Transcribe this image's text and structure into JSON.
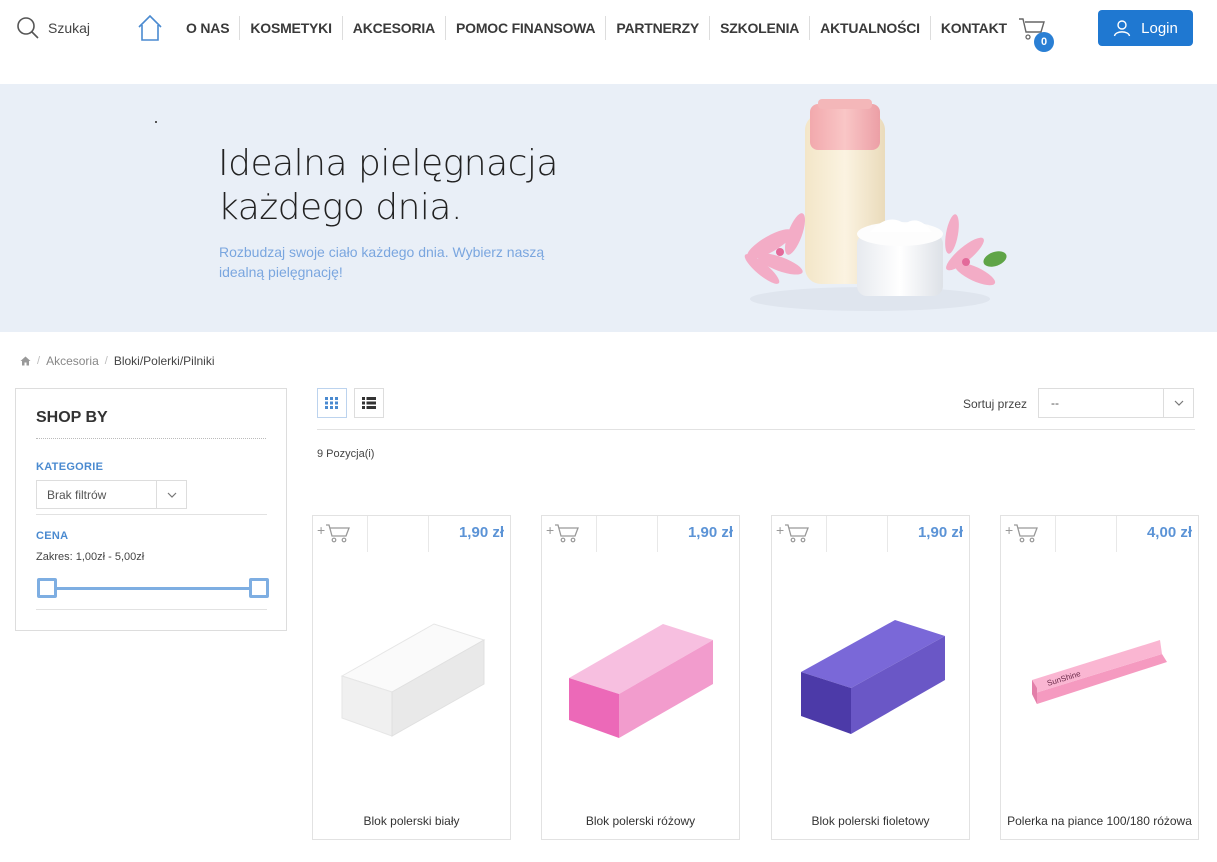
{
  "header": {
    "search_label": "Szukaj",
    "nav": [
      "O NAS",
      "KOSMETYKI",
      "AKCESORIA",
      "POMOC FINANSOWA",
      "PARTNERZY",
      "SZKOLENIA",
      "AKTUALNOŚCI",
      "KONTAKT"
    ],
    "cart_count": "0",
    "login_label": "Login"
  },
  "banner": {
    "title_line1": "Idealna pielęgnacja",
    "title_line2": "każdego dnia.",
    "subtitle_line1": "Rozbudzaj swoje ciało każdego dnia. Wybierz naszą",
    "subtitle_line2": "idealną pielęgnację!"
  },
  "breadcrumb": {
    "items": [
      "Akcesoria",
      "Bloki/Polerki/Pilniki"
    ]
  },
  "sidebar": {
    "title": "SHOP BY",
    "category_label": "KATEGORIE",
    "category_value": "Brak filtrów",
    "price_label": "CENA",
    "price_range": "Zakres: 1,00zł - 5,00zł"
  },
  "toolbar": {
    "sort_label": "Sortuj przez",
    "sort_value": "--",
    "count_text": "9 Pozycja(i)"
  },
  "products": [
    {
      "name": "Blok polerski biały",
      "price": "1,90 zł",
      "color": "#f1f1f1"
    },
    {
      "name": "Blok polerski różowy",
      "price": "1,90 zł",
      "color": "#f3a9d3"
    },
    {
      "name": "Blok polerski fioletowy",
      "price": "1,90 zł",
      "color": "#6a57c6"
    },
    {
      "name": "Polerka na piance 100/180 różowa",
      "price": "4,00 zł",
      "color": "#f7a6c8",
      "brand": "SunShine"
    }
  ],
  "colors": {
    "accent": "#1f78d1",
    "price": "#5b93d6",
    "banner_bg": "#e9eff7"
  }
}
